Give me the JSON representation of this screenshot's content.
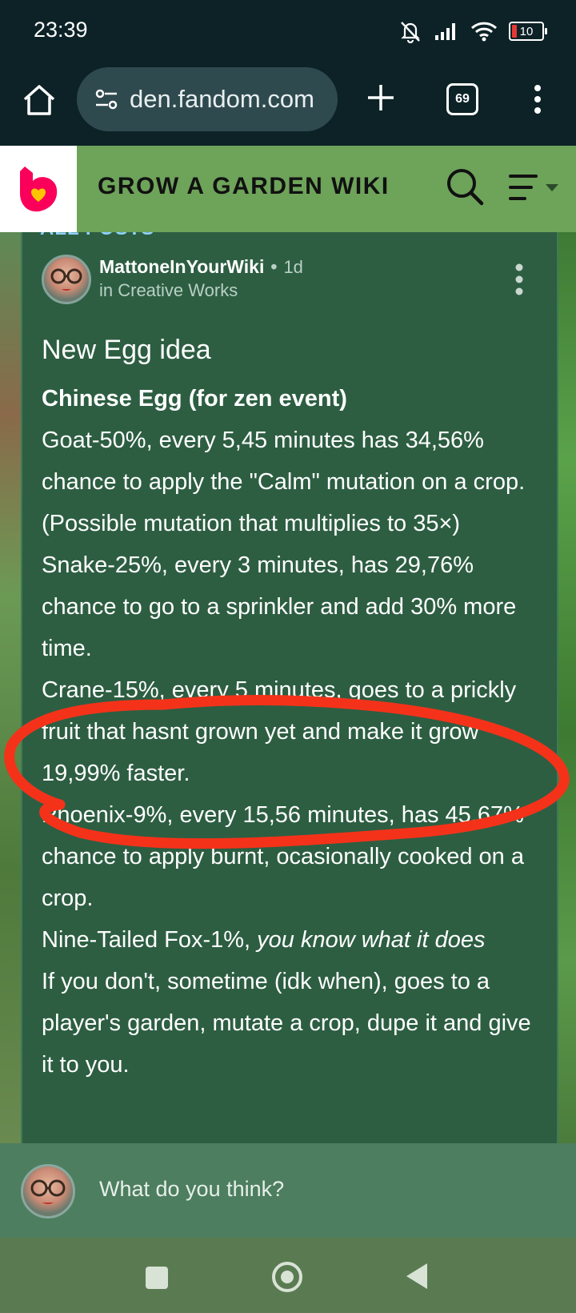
{
  "status_bar": {
    "time": "23:39",
    "battery": "10",
    "icons": [
      "mute-bell-icon",
      "signal-icon",
      "wifi-icon",
      "battery-icon"
    ]
  },
  "browser": {
    "url": "den.fandom.com",
    "tab_count": "69",
    "icons": [
      "home-icon",
      "site-settings-icon",
      "new-tab-plus-icon",
      "tabs-icon",
      "overflow-menu-icon"
    ]
  },
  "wiki_header": {
    "title": "GROW A GARDEN WIKI",
    "icons": [
      "fandom-logo",
      "search-icon",
      "menu-icon"
    ]
  },
  "post": {
    "back_link": "ALL POSTS",
    "author": "MattoneInYourWiki",
    "separator": "•",
    "time_ago": "1d",
    "category": "in Creative Works",
    "title": "New Egg idea",
    "heading": "Chinese Egg (for zen event)",
    "lines": [
      "Goat-50%, every 5,45 minutes has 34,56% chance to apply the \"Calm\" mutation on a crop. (Possible mutation that multiplies to 35×)",
      "Snake-25%, every 3 minutes, has 29,76% chance to go to a sprinkler and add 30% more time.",
      "Crane-15%, every 5 minutes, goes to a prickly fruit that hasnt grown yet and make it grow 19,99% faster.",
      "Phoenix-9%, every 15,56 minutes, has 45,67% chance to apply burnt, ocasionally cooked on a crop."
    ],
    "fox_line_prefix": "Nine-Tailed Fox-1%, ",
    "fox_line_italic": "you know what it does",
    "last_line": "If you don't, sometime (idk when), goes to a player's garden, mutate a crop, dupe it and give it to you."
  },
  "comment_bar": {
    "placeholder": "What do you think?"
  },
  "annotation": {
    "color": "#f4321a"
  },
  "nav": {
    "icons": [
      "recents-icon",
      "home-icon",
      "back-icon"
    ]
  }
}
